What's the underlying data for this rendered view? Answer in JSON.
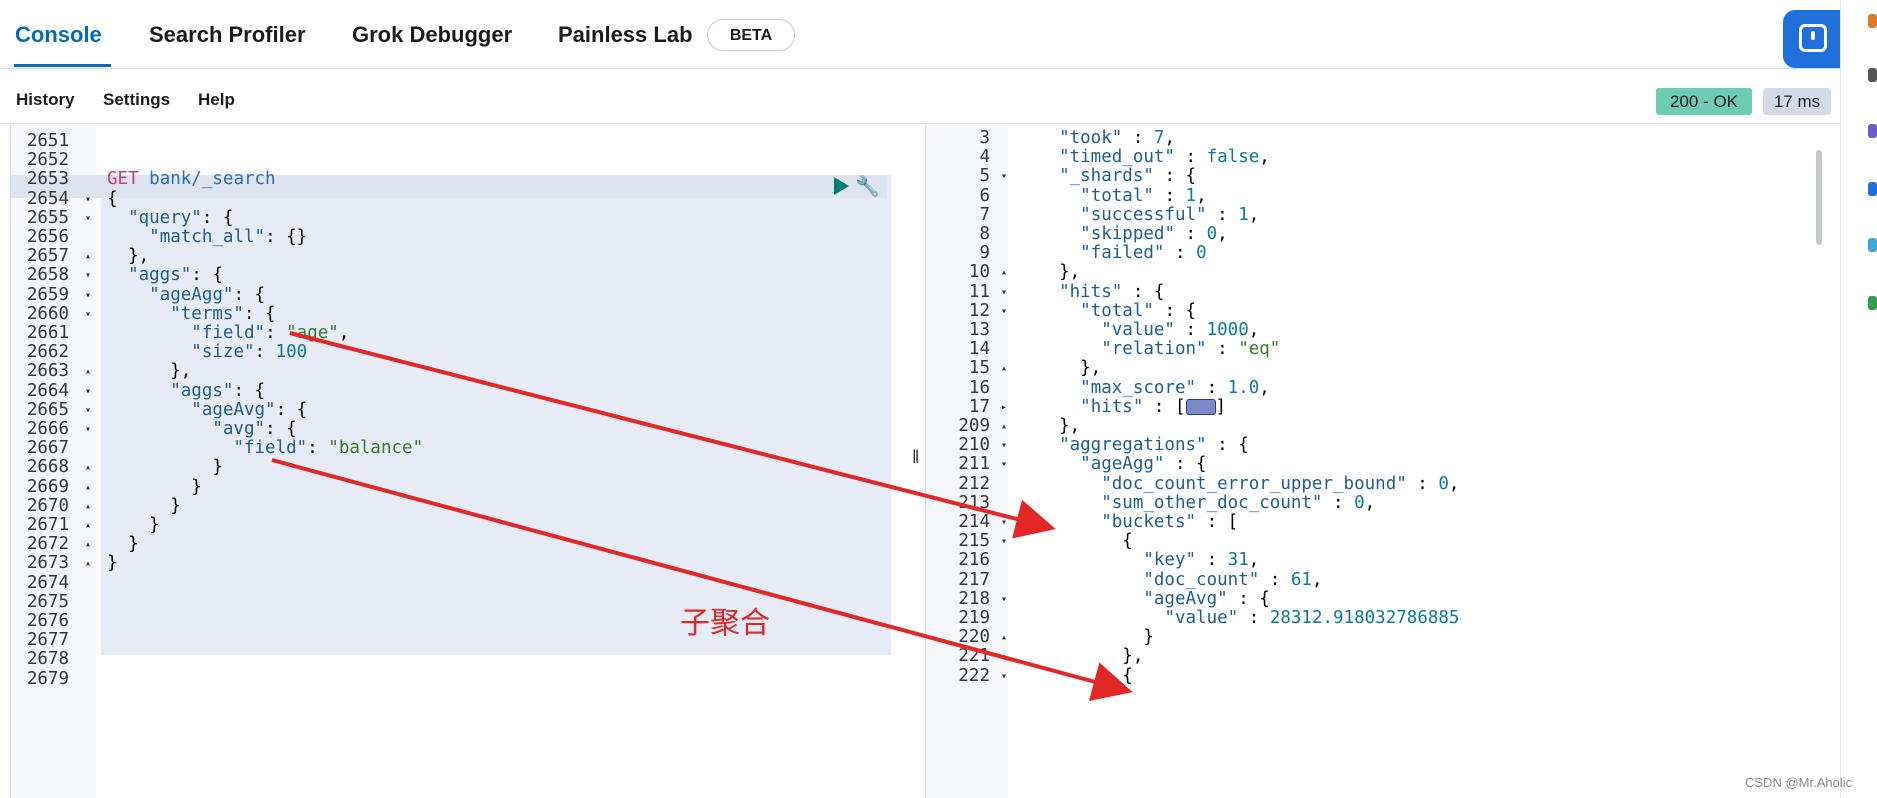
{
  "tabs": [
    "Console",
    "Search Profiler",
    "Grok Debugger",
    "Painless Lab"
  ],
  "beta_badge": "BETA",
  "menu": [
    "History",
    "Settings",
    "Help"
  ],
  "status": "200 - OK",
  "timing": "17 ms",
  "request_lines": [
    {
      "n": "2651",
      "f": "",
      "t": ""
    },
    {
      "n": "2652",
      "f": "",
      "t": ""
    },
    {
      "n": "2653",
      "f": "",
      "t": "GET bank/_search"
    },
    {
      "n": "2654",
      "f": "▾",
      "t": "{"
    },
    {
      "n": "2655",
      "f": "▾",
      "t": "  \"query\": {"
    },
    {
      "n": "2656",
      "f": "",
      "t": "    \"match_all\": {}"
    },
    {
      "n": "2657",
      "f": "▴",
      "t": "  },"
    },
    {
      "n": "2658",
      "f": "▾",
      "t": "  \"aggs\": {"
    },
    {
      "n": "2659",
      "f": "▾",
      "t": "    \"ageAgg\": {"
    },
    {
      "n": "2660",
      "f": "▾",
      "t": "      \"terms\": {"
    },
    {
      "n": "2661",
      "f": "",
      "t": "        \"field\": \"age\","
    },
    {
      "n": "2662",
      "f": "",
      "t": "        \"size\": 100"
    },
    {
      "n": "2663",
      "f": "▴",
      "t": "      },"
    },
    {
      "n": "2664",
      "f": "▾",
      "t": "      \"aggs\": {"
    },
    {
      "n": "2665",
      "f": "▾",
      "t": "        \"ageAvg\": {"
    },
    {
      "n": "2666",
      "f": "▾",
      "t": "          \"avg\": {"
    },
    {
      "n": "2667",
      "f": "",
      "t": "            \"field\": \"balance\""
    },
    {
      "n": "2668",
      "f": "▴",
      "t": "          }"
    },
    {
      "n": "2669",
      "f": "▴",
      "t": "        }"
    },
    {
      "n": "2670",
      "f": "▴",
      "t": "      }"
    },
    {
      "n": "2671",
      "f": "▴",
      "t": "    }"
    },
    {
      "n": "2672",
      "f": "▴",
      "t": "  }"
    },
    {
      "n": "2673",
      "f": "▴",
      "t": "}"
    },
    {
      "n": "2674",
      "f": "",
      "t": ""
    },
    {
      "n": "2675",
      "f": "",
      "t": ""
    },
    {
      "n": "2676",
      "f": "",
      "t": ""
    },
    {
      "n": "2677",
      "f": "",
      "t": ""
    },
    {
      "n": "2678",
      "f": "",
      "t": ""
    },
    {
      "n": "2679",
      "f": "",
      "t": ""
    }
  ],
  "response_lines": [
    {
      "n": "3",
      "f": "",
      "t": "  \"took\" : 7,"
    },
    {
      "n": "4",
      "f": "",
      "t": "  \"timed_out\" : false,"
    },
    {
      "n": "5",
      "f": "▾",
      "t": "  \"_shards\" : {"
    },
    {
      "n": "6",
      "f": "",
      "t": "    \"total\" : 1,"
    },
    {
      "n": "7",
      "f": "",
      "t": "    \"successful\" : 1,"
    },
    {
      "n": "8",
      "f": "",
      "t": "    \"skipped\" : 0,"
    },
    {
      "n": "9",
      "f": "",
      "t": "    \"failed\" : 0"
    },
    {
      "n": "10",
      "f": "▴",
      "t": "  },"
    },
    {
      "n": "11",
      "f": "▾",
      "t": "  \"hits\" : {"
    },
    {
      "n": "12",
      "f": "▾",
      "t": "    \"total\" : {"
    },
    {
      "n": "13",
      "f": "",
      "t": "      \"value\" : 1000,"
    },
    {
      "n": "14",
      "f": "",
      "t": "      \"relation\" : \"eq\""
    },
    {
      "n": "15",
      "f": "▴",
      "t": "    },"
    },
    {
      "n": "16",
      "f": "",
      "t": "    \"max_score\" : 1.0,"
    },
    {
      "n": "17",
      "f": "▸",
      "t": "    \"hits\" : [@@]"
    },
    {
      "n": "209",
      "f": "▴",
      "t": "  },"
    },
    {
      "n": "210",
      "f": "▾",
      "t": "  \"aggregations\" : {"
    },
    {
      "n": "211",
      "f": "▾",
      "t": "    \"ageAgg\" : {"
    },
    {
      "n": "212",
      "f": "",
      "t": "      \"doc_count_error_upper_bound\" : 0,"
    },
    {
      "n": "213",
      "f": "",
      "t": "      \"sum_other_doc_count\" : 0,"
    },
    {
      "n": "214",
      "f": "▾",
      "t": "      \"buckets\" : ["
    },
    {
      "n": "215",
      "f": "▾",
      "t": "        {"
    },
    {
      "n": "216",
      "f": "",
      "t": "          \"key\" : 31,"
    },
    {
      "n": "217",
      "f": "",
      "t": "          \"doc_count\" : 61,"
    },
    {
      "n": "218",
      "f": "▾",
      "t": "          \"ageAvg\" : {"
    },
    {
      "n": "219",
      "f": "",
      "t": "            \"value\" : 28312.918032786885"
    },
    {
      "n": "220",
      "f": "▴",
      "t": "          }"
    },
    {
      "n": "221",
      "f": "▴",
      "t": "        },"
    },
    {
      "n": "222",
      "f": "▾",
      "t": "        {"
    }
  ],
  "annotation": "子聚合",
  "watermark": "CSDN @Mr.Aholic"
}
